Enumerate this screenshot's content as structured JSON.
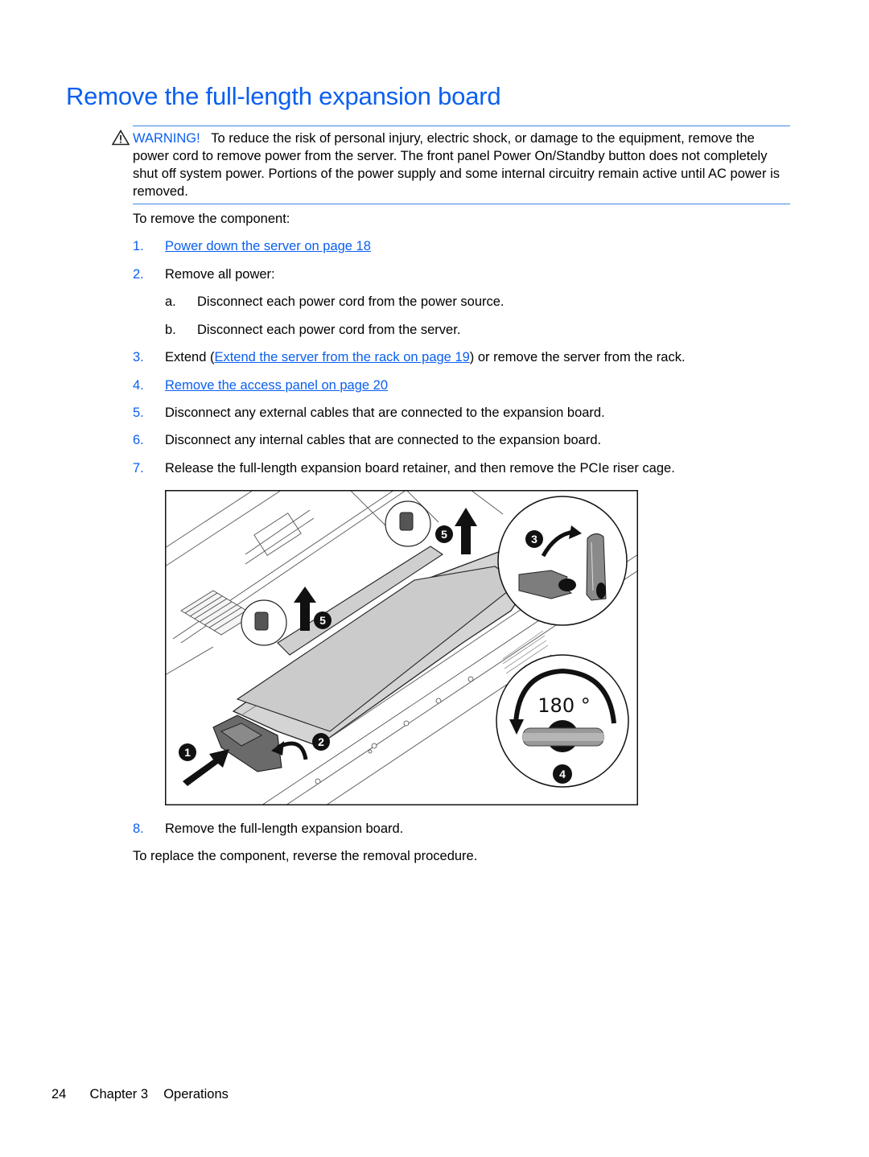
{
  "page": {
    "title": "Remove the full-length expansion board",
    "accent_color": "#0a5ff0"
  },
  "warning": {
    "icon": "warning-triangle-icon",
    "label": "WARNING!",
    "text": "To reduce the risk of personal injury, electric shock, or damage to the equipment, remove the power cord to remove power from the server. The front panel Power On/Standby button does not completely shut off system power. Portions of the power supply and some internal circuitry remain active until AC power is removed."
  },
  "intro": "To remove the component:",
  "steps": [
    {
      "num": "1.",
      "link": "Power down the server on page 18"
    },
    {
      "num": "2.",
      "text": "Remove all power:",
      "substeps": [
        {
          "num": "a.",
          "text": "Disconnect each power cord from the power source."
        },
        {
          "num": "b.",
          "text": "Disconnect each power cord from the server."
        }
      ]
    },
    {
      "num": "3.",
      "pre": "Extend (",
      "link": "Extend the server from the rack on page 19",
      "post": ") or remove the server from the rack."
    },
    {
      "num": "4.",
      "link": "Remove the access panel on page 20"
    },
    {
      "num": "5.",
      "text": "Disconnect any external cables that are connected to the expansion board."
    },
    {
      "num": "6.",
      "text": "Disconnect any internal cables that are connected to the expansion board."
    },
    {
      "num": "7.",
      "text": "Release the full-length expansion board retainer, and then remove the PCIe riser cage."
    },
    {
      "num": "8.",
      "text": "Remove the full-length expansion board."
    }
  ],
  "figure": {
    "description": "Illustration: removing PCIe riser cage and full-length expansion board retainer",
    "callouts": [
      "1",
      "2",
      "3",
      "4",
      "5",
      "5"
    ],
    "rotation_label": "180 °"
  },
  "outro": "To replace the component, reverse the removal procedure.",
  "footer": {
    "page_number": "24",
    "chapter": "Chapter 3",
    "section": "Operations"
  }
}
